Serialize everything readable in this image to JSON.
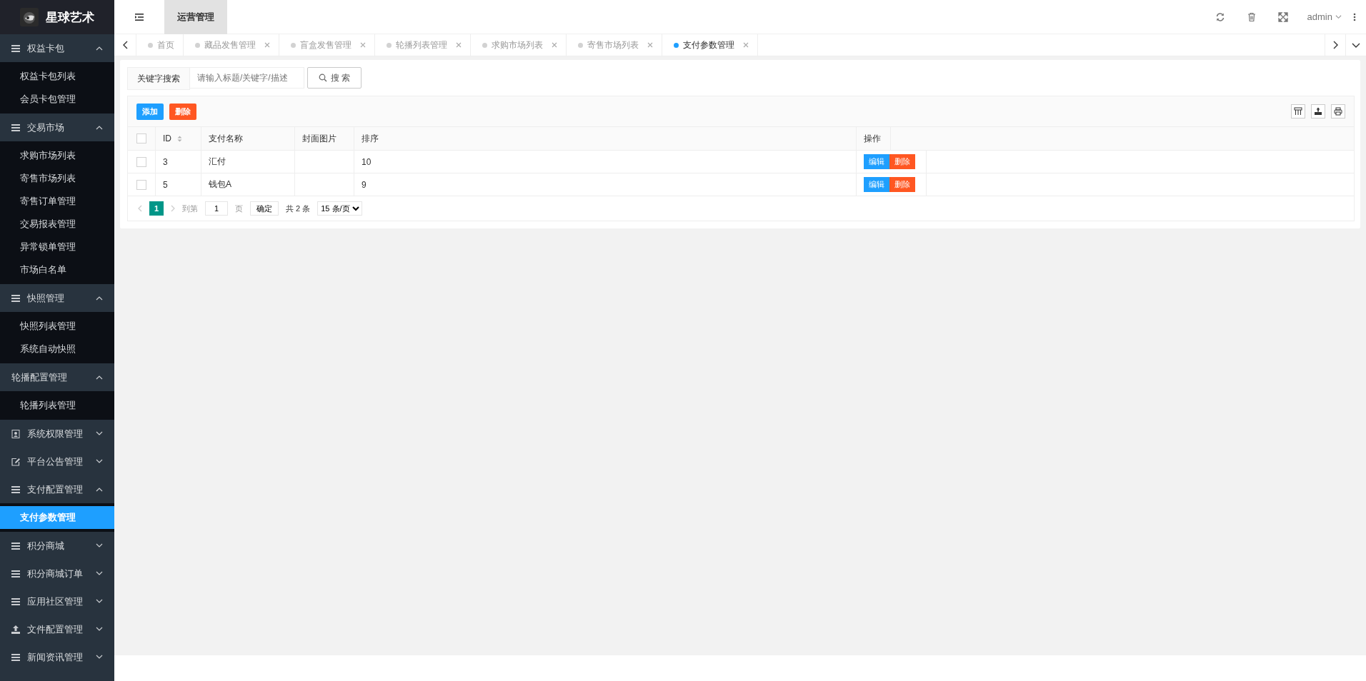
{
  "brand": {
    "name": "星球艺术"
  },
  "sidebar": {
    "groups": [
      {
        "label": "权益卡包",
        "kind": "list",
        "expanded": true,
        "children": [
          {
            "label": "权益卡包列表",
            "selected": false
          },
          {
            "label": "会员卡包管理",
            "selected": false
          }
        ]
      },
      {
        "label": "交易市场",
        "kind": "list",
        "expanded": true,
        "children": [
          {
            "label": "求购市场列表",
            "selected": false
          },
          {
            "label": "寄售市场列表",
            "selected": false
          },
          {
            "label": "寄售订单管理",
            "selected": false
          },
          {
            "label": "交易报表管理",
            "selected": false
          },
          {
            "label": "异常锁单管理",
            "selected": false
          },
          {
            "label": "市场白名单",
            "selected": false
          }
        ]
      },
      {
        "label": "快照管理",
        "kind": "list",
        "expanded": true,
        "children": [
          {
            "label": "快照列表管理",
            "selected": false
          },
          {
            "label": "系统自动快照",
            "selected": false
          }
        ]
      },
      {
        "label": "轮播配置管理",
        "kind": "plain",
        "expanded": true,
        "children": [
          {
            "label": "轮播列表管理",
            "selected": false
          }
        ]
      },
      {
        "label": "系统权限管理",
        "kind": "contacts",
        "expanded": false
      },
      {
        "label": "平台公告管理",
        "kind": "edit",
        "expanded": false
      },
      {
        "label": "支付配置管理",
        "kind": "list",
        "expanded": true,
        "children": [
          {
            "label": "支付参数管理",
            "selected": true
          }
        ]
      },
      {
        "label": "积分商城",
        "kind": "list",
        "expanded": false
      },
      {
        "label": "积分商城订单",
        "kind": "list",
        "expanded": false
      },
      {
        "label": "应用社区管理",
        "kind": "list",
        "expanded": false
      },
      {
        "label": "文件配置管理",
        "kind": "upload",
        "expanded": false
      },
      {
        "label": "新闻资讯管理",
        "kind": "list",
        "expanded": false
      }
    ]
  },
  "topbar": {
    "menus": [
      {
        "label": "运营管理",
        "selected": true
      }
    ],
    "user": "admin"
  },
  "tabs": [
    {
      "label": "首页",
      "selected": false,
      "closable": false
    },
    {
      "label": "藏品发售管理",
      "selected": false,
      "closable": true
    },
    {
      "label": "盲盒发售管理",
      "selected": false,
      "closable": true
    },
    {
      "label": "轮播列表管理",
      "selected": false,
      "closable": true
    },
    {
      "label": "求购市场列表",
      "selected": false,
      "closable": true
    },
    {
      "label": "寄售市场列表",
      "selected": false,
      "closable": true
    },
    {
      "label": "支付参数管理",
      "selected": true,
      "closable": true
    }
  ],
  "search": {
    "label": "关键字搜索",
    "placeholder": "请输入标题/关键字/描述",
    "button": "搜 索"
  },
  "toolbar": {
    "buttons": [
      {
        "label": "添加",
        "kind": "primary"
      },
      {
        "label": "删除",
        "kind": "danger"
      }
    ]
  },
  "table": {
    "select_all_checked": false,
    "columns": [
      {
        "label": "ID",
        "sortable": true
      },
      {
        "label": "支付名称",
        "sortable": false
      },
      {
        "label": "封面图片",
        "sortable": false
      },
      {
        "label": "排序",
        "sortable": false
      },
      {
        "label": "操作",
        "sortable": false
      }
    ],
    "rows": [
      {
        "checked": false,
        "id": "3",
        "name": "汇付",
        "order": "10",
        "actions": [
          {
            "label": "编辑",
            "kind": "primary"
          },
          {
            "label": "删除",
            "kind": "danger"
          }
        ]
      },
      {
        "checked": false,
        "id": "5",
        "name": "钱包A",
        "order": "9",
        "actions": [
          {
            "label": "编辑",
            "kind": "primary"
          },
          {
            "label": "删除",
            "kind": "danger"
          }
        ]
      }
    ]
  },
  "pagination": {
    "pages": [
      {
        "label": "1",
        "selected": true
      }
    ],
    "goto_label": "到第",
    "page_value": "1",
    "page_unit": "页",
    "confirm": "确定",
    "total": "共 2 条",
    "page_size": "15 条/页"
  }
}
